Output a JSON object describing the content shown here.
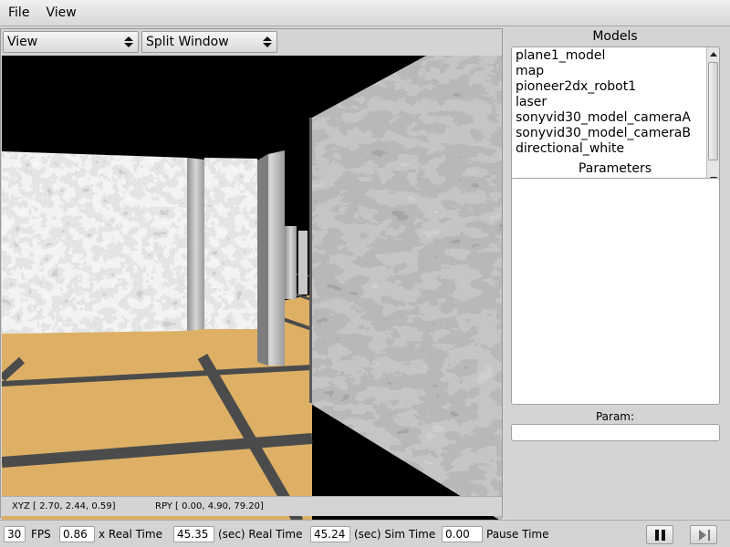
{
  "menu": {
    "file": "File",
    "view": "View"
  },
  "view_panel": {
    "view_select": "View",
    "layout_select": "Split Window",
    "xyz_readout": "XYZ [  2.70,   2.44,   0.59]",
    "rpy_readout": "RPY [  0.00,   4.90,  79.20]"
  },
  "models": {
    "title": "Models",
    "items": [
      "plane1_model",
      "map",
      "pioneer2dx_robot1",
      "laser",
      "sonyvid30_model_cameraA",
      "sonyvid30_model_cameraB",
      "directional_white"
    ]
  },
  "parameters": {
    "title": "Parameters",
    "param_label": "Param:",
    "param_value": ""
  },
  "statusbar": {
    "fps_value": "30",
    "fps_label": "FPS",
    "real_time_factor": "0.86",
    "real_time_factor_label": "x Real Time",
    "real_time": "45.35",
    "real_time_label": "(sec) Real Time",
    "sim_time": "45.24",
    "sim_time_label": "(sec) Sim Time",
    "pause_time": "0.00",
    "pause_time_label": "Pause Time"
  },
  "icons": {
    "view_select": "updown-arrows-icon",
    "layout_select": "updown-arrows-icon",
    "pause": "pause-icon",
    "step": "step-forward-icon"
  },
  "colors": {
    "floor": "#ddb066",
    "floor_lines": "#4b4b4b",
    "sky": "#000000",
    "wall_light": "#e2e2e2",
    "wall_dark": "#8a8a8a"
  }
}
